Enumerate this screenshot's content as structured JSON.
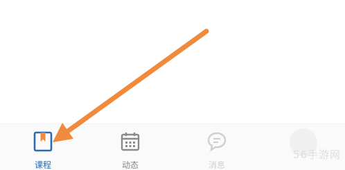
{
  "bottom_nav": {
    "items": [
      {
        "label": "课程",
        "icon": "bookmark-book-icon",
        "active": true
      },
      {
        "label": "动态",
        "icon": "calendar-icon",
        "active": false
      },
      {
        "label": "消息",
        "icon": "chat-bubble-icon",
        "active": false
      },
      {
        "label": "",
        "icon": "avatar",
        "active": false
      }
    ]
  },
  "overlay": {
    "arrow_color": "#f08a3c",
    "watermark": "56手游网"
  },
  "colors": {
    "active": "#2b6cb0",
    "inactive_icon": "#8a8a8a",
    "faded_icon": "#cfcfcf"
  }
}
